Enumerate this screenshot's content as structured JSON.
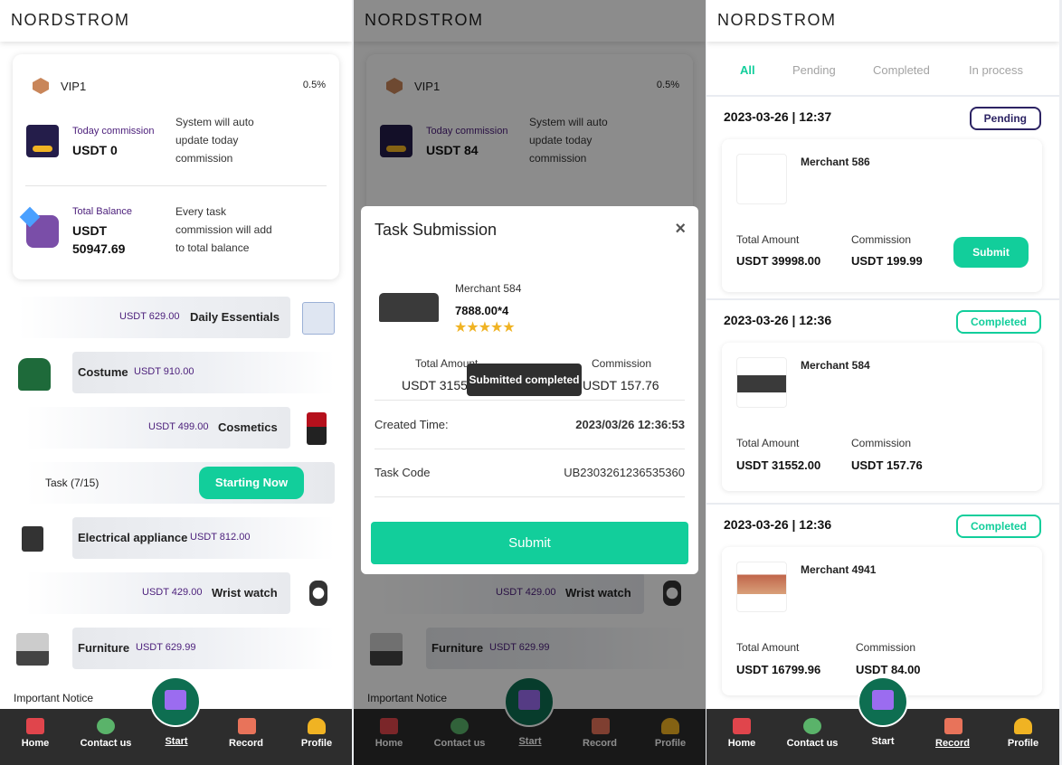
{
  "brand": "NORDSTROM",
  "colors": {
    "accent": "#12ce9b",
    "purple": "#4a1d7a",
    "nav": "#2d2d2d",
    "pending": "#2c2363",
    "completed": "#12ce9b"
  },
  "home": {
    "vip_label": "VIP1",
    "commission_rate": "0.5%",
    "today_commission_label": "Today commission",
    "today_commission_value": "USDT 0",
    "today_desc": "System will auto update today commission",
    "total_balance_label": "Total Balance",
    "total_balance_currency": "USDT",
    "total_balance_amount": "50947.69",
    "balance_desc": "Every task commission will add to total balance",
    "categories": [
      {
        "name": "Daily Essentials",
        "price": "USDT 629.00",
        "icon": "mask-icon"
      },
      {
        "name": "Costume",
        "price": "USDT 910.00",
        "icon": "sweater-icon"
      },
      {
        "name": "Cosmetics",
        "price": "USDT 499.00",
        "icon": "lipstick-icon"
      },
      {
        "name": "Electrical appliance",
        "price": "USDT 812.00",
        "icon": "washer-icon"
      },
      {
        "name": "Wrist watch",
        "price": "USDT 429.00",
        "icon": "watch-icon"
      },
      {
        "name": "Furniture",
        "price": "USDT 629.99",
        "icon": "sofa-icon"
      }
    ],
    "task_label": "Task (7/15)",
    "starting_now": "Starting Now",
    "important_notice": "Important Notice"
  },
  "home2": {
    "today_commission_value": "USDT 84"
  },
  "nav": {
    "home": "Home",
    "contact": "Contact us",
    "start": "Start",
    "record": "Record",
    "profile": "Profile"
  },
  "modal": {
    "title": "Task Submission",
    "close": "×",
    "merchant": "Merchant 584",
    "price": "7888.00*4",
    "stars": "★★★★★",
    "total_amount_label": "Total Amount",
    "total_amount_value": "USDT 31552.00",
    "commission_label": "Commission",
    "commission_value": "USDT 157.76",
    "created_label": "Created Time:",
    "created_value": "2023/03/26 12:36:53",
    "code_label": "Task Code",
    "code_value": "UB2303261236535360",
    "submit": "Submit",
    "toast": "Submitted completed"
  },
  "record": {
    "tabs": [
      "All",
      "Pending",
      "Completed",
      "In process"
    ],
    "items": [
      {
        "date": "2023-03-26 | 12:37",
        "status": "Pending",
        "merchant": "Merchant 586",
        "total_label": "Total Amount",
        "total": "USDT 39998.00",
        "commission_label": "Commission",
        "commission": "USDT 199.99",
        "submit": "Submit"
      },
      {
        "date": "2023-03-26 | 12:36",
        "status": "Completed",
        "merchant": "Merchant 584",
        "total_label": "Total Amount",
        "total": "USDT 31552.00",
        "commission_label": "Commission",
        "commission": "USDT 157.76"
      },
      {
        "date": "2023-03-26 | 12:36",
        "status": "Completed",
        "merchant": "Merchant 4941",
        "total_label": "Total Amount",
        "total": "USDT 16799.96",
        "commission_label": "Commission",
        "commission": "USDT 84.00"
      }
    ]
  }
}
